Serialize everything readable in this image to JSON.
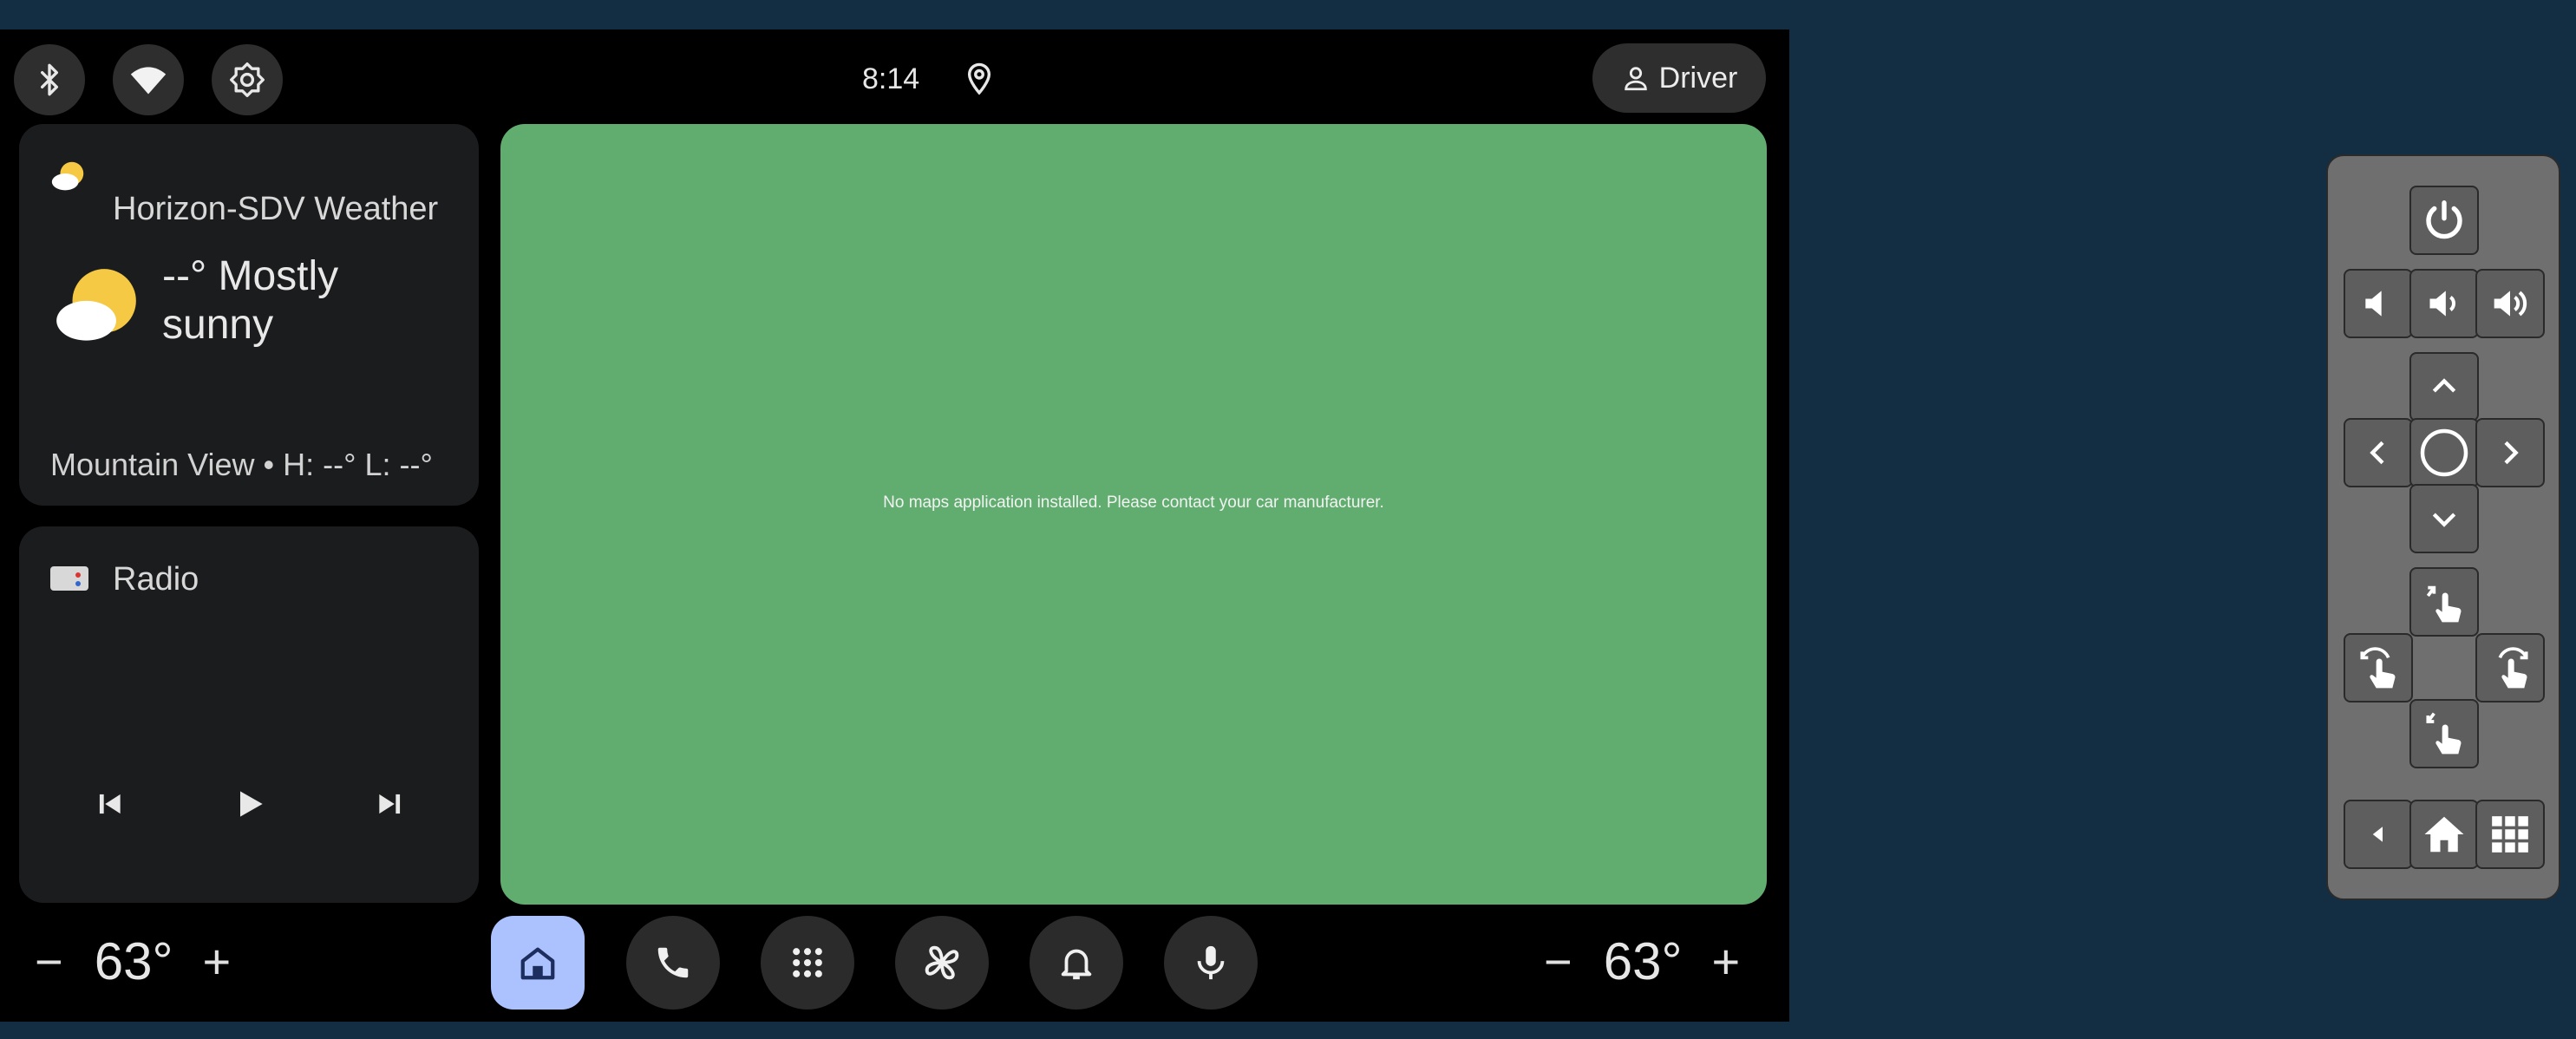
{
  "status_bar": {
    "icons": [
      "bluetooth-icon",
      "wifi-icon",
      "brightness-icon",
      "location-pin-icon"
    ],
    "time": "8:14",
    "profile_label": "Driver"
  },
  "weather_card": {
    "title": "Horizon-SDV Weather",
    "condition": "--° Mostly sunny",
    "location_line": "Mountain View • H: --° L: --°"
  },
  "radio_card": {
    "title": "Radio",
    "controls": [
      "skip-previous-icon",
      "play-icon",
      "skip-next-icon"
    ]
  },
  "map": {
    "message": "No maps application installed. Please contact your car manufacturer.",
    "background": "#61ad70"
  },
  "bottom_bar": {
    "left_temp": "63°",
    "right_temp": "63°",
    "minus": "−",
    "plus": "+",
    "dock": [
      "home-icon",
      "phone-icon",
      "app-grid-icon",
      "fan-icon",
      "bell-icon",
      "microphone-icon"
    ],
    "active_accent": "#abc2ff"
  },
  "remote": {
    "buttons": [
      "power",
      "volume-mute",
      "volume-down",
      "volume-up",
      "up",
      "left",
      "select",
      "right",
      "down",
      "swipe-up",
      "rotate-left",
      "rotate-right",
      "swipe-down",
      "back",
      "home",
      "apps"
    ]
  }
}
